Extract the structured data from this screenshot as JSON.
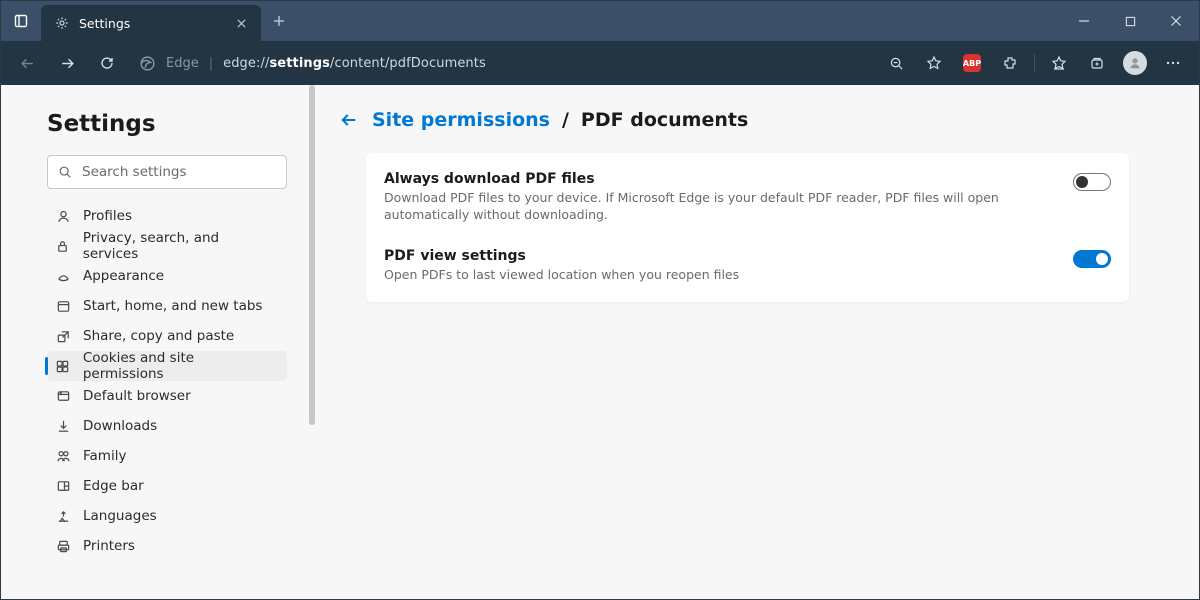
{
  "window": {
    "tab_title": "Settings"
  },
  "toolbar": {
    "edge_label": "Edge",
    "url_prefix": "edge://",
    "url_bold": "settings",
    "url_rest": "/content/pdfDocuments"
  },
  "sidebar": {
    "title": "Settings",
    "search_placeholder": "Search settings",
    "items": [
      {
        "label": "Profiles",
        "active": false
      },
      {
        "label": "Privacy, search, and services",
        "active": false
      },
      {
        "label": "Appearance",
        "active": false
      },
      {
        "label": "Start, home, and new tabs",
        "active": false
      },
      {
        "label": "Share, copy and paste",
        "active": false
      },
      {
        "label": "Cookies and site permissions",
        "active": true
      },
      {
        "label": "Default browser",
        "active": false
      },
      {
        "label": "Downloads",
        "active": false
      },
      {
        "label": "Family",
        "active": false
      },
      {
        "label": "Edge bar",
        "active": false
      },
      {
        "label": "Languages",
        "active": false
      },
      {
        "label": "Printers",
        "active": false
      }
    ]
  },
  "main": {
    "breadcrumb_parent": "Site permissions",
    "breadcrumb_current": "PDF documents",
    "settings": [
      {
        "title": "Always download PDF files",
        "description": "Download PDF files to your device. If Microsoft Edge is your default PDF reader, PDF files will open automatically without downloading.",
        "on": false
      },
      {
        "title": "PDF view settings",
        "description": "Open PDFs to last viewed location when you reopen files",
        "on": true
      }
    ]
  }
}
